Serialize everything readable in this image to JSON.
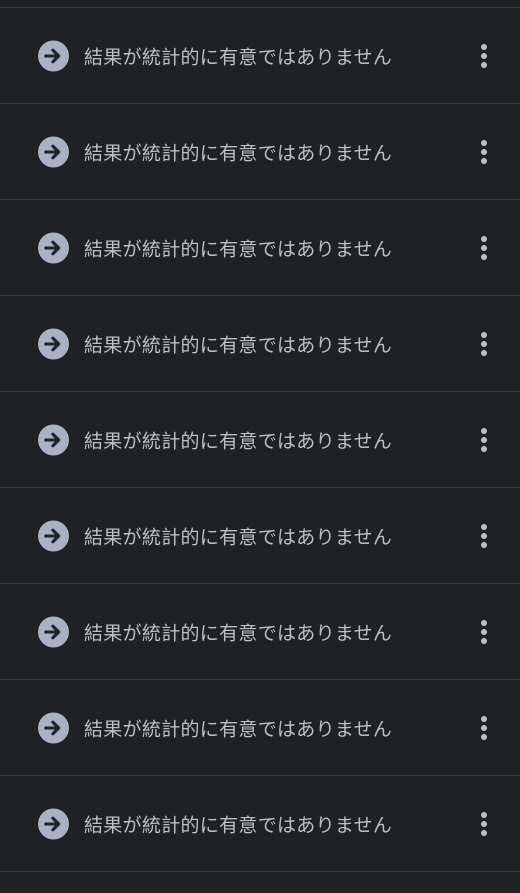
{
  "list": {
    "items": [
      {
        "label": "結果が統計的に有意ではありません",
        "icon": "arrow-right-circle-icon",
        "menu_icon": "more-vert-icon"
      },
      {
        "label": "結果が統計的に有意ではありません",
        "icon": "arrow-right-circle-icon",
        "menu_icon": "more-vert-icon"
      },
      {
        "label": "結果が統計的に有意ではありません",
        "icon": "arrow-right-circle-icon",
        "menu_icon": "more-vert-icon"
      },
      {
        "label": "結果が統計的に有意ではありません",
        "icon": "arrow-right-circle-icon",
        "menu_icon": "more-vert-icon"
      },
      {
        "label": "結果が統計的に有意ではありません",
        "icon": "arrow-right-circle-icon",
        "menu_icon": "more-vert-icon"
      },
      {
        "label": "結果が統計的に有意ではありません",
        "icon": "arrow-right-circle-icon",
        "menu_icon": "more-vert-icon"
      },
      {
        "label": "結果が統計的に有意ではありません",
        "icon": "arrow-right-circle-icon",
        "menu_icon": "more-vert-icon"
      },
      {
        "label": "結果が統計的に有意ではありません",
        "icon": "arrow-right-circle-icon",
        "menu_icon": "more-vert-icon"
      },
      {
        "label": "結果が統計的に有意ではありません",
        "icon": "arrow-right-circle-icon",
        "menu_icon": "more-vert-icon"
      }
    ]
  },
  "colors": {
    "background": "#202124",
    "divider": "#3c4043",
    "text": "#bdc1c6",
    "icon_fill": "#a8b0c2",
    "icon_arrow": "#202124"
  }
}
